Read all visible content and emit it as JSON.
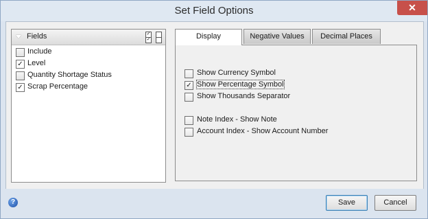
{
  "window": {
    "title": "Set Field Options",
    "close_glyph": "✕"
  },
  "fields": {
    "header_label": "Fields",
    "items": [
      {
        "label": "Include",
        "checked": false
      },
      {
        "label": "Level",
        "checked": true
      },
      {
        "label": "Quantity Shortage Status",
        "checked": false
      },
      {
        "label": "Scrap Percentage",
        "checked": true
      }
    ]
  },
  "tabs": [
    {
      "label": "Display",
      "active": true
    },
    {
      "label": "Negative Values",
      "active": false
    },
    {
      "label": "Decimal Places",
      "active": false
    }
  ],
  "display_options": [
    {
      "label": "Show Currency Symbol",
      "checked": false
    },
    {
      "label": "Show Percentage Symbol",
      "checked": true
    },
    {
      "label": "Show Thousands Separator",
      "checked": false
    },
    {
      "label": "Note Index - Show Note",
      "checked": false
    },
    {
      "label": "Account Index - Show Account Number",
      "checked": false
    }
  ],
  "footer": {
    "save_label": "Save",
    "cancel_label": "Cancel",
    "help_glyph": "?"
  },
  "checkmark_glyph": "✓"
}
